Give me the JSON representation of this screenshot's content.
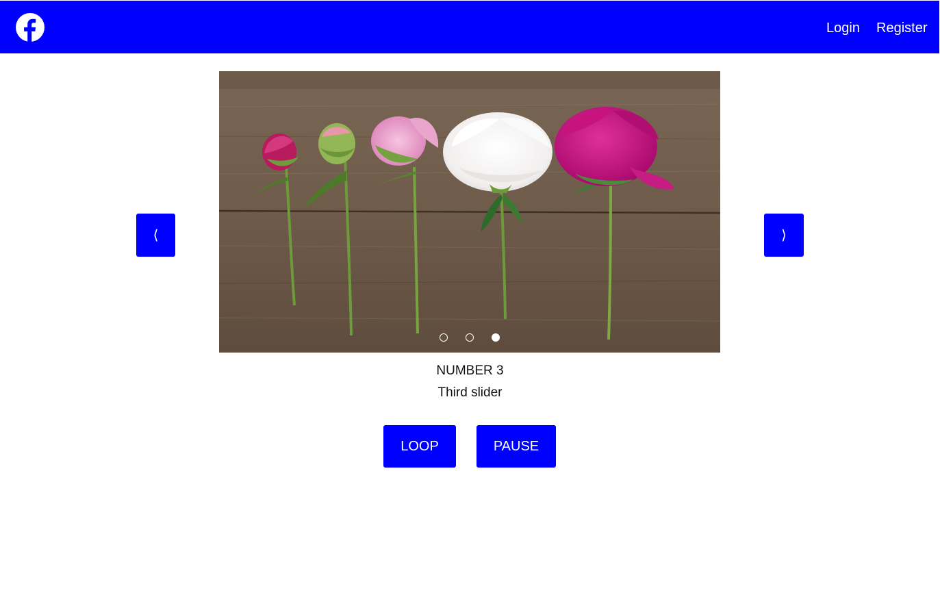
{
  "header": {
    "logo_icon": "facebook-logo-icon",
    "brand_color": "#0000ff",
    "links": [
      {
        "label": "Login"
      },
      {
        "label": "Register"
      }
    ]
  },
  "slider": {
    "prev_label": "⟨",
    "next_label": "⟩",
    "total_slides": 3,
    "current_slide": 3,
    "caption_title": "NUMBER 3",
    "caption_text": "Third slider"
  },
  "controls": {
    "loop_label": "LOOP",
    "pause_label": "PAUSE"
  }
}
